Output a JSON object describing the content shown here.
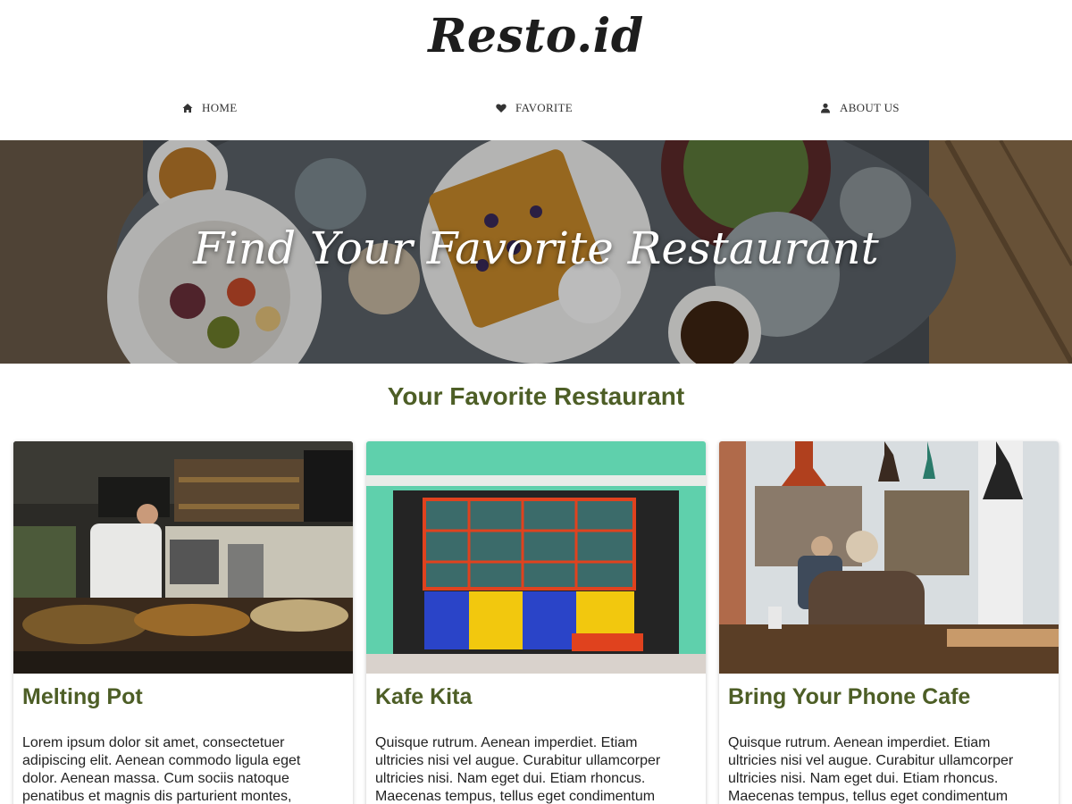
{
  "brand": {
    "logo": "Resto.id"
  },
  "nav": {
    "items": [
      {
        "label": "HOME",
        "icon": "home-icon"
      },
      {
        "label": "FAVORITE",
        "icon": "heart-icon"
      },
      {
        "label": "ABOUT US",
        "icon": "user-icon"
      }
    ]
  },
  "hero": {
    "title": "Find Your Favorite Restaurant"
  },
  "section": {
    "title": "Your Favorite Restaurant"
  },
  "restaurants": [
    {
      "name": "Melting Pot",
      "description": "Lorem ipsum dolor sit amet, consectetuer adipiscing elit. Aenean commodo ligula eget dolor. Aenean massa. Cum sociis natoque penatibus et magnis dis parturient montes,"
    },
    {
      "name": "Kafe Kita",
      "description": "Quisque rutrum. Aenean imperdiet. Etiam ultricies nisi vel augue. Curabitur ullamcorper ultricies nisi. Nam eget dui. Etiam rhoncus. Maecenas tempus, tellus eget condimentum"
    },
    {
      "name": "Bring Your Phone Cafe",
      "description": "Quisque rutrum. Aenean imperdiet. Etiam ultricies nisi vel augue. Curabitur ullamcorper ultricies nisi. Nam eget dui. Etiam rhoncus. Maecenas tempus, tellus eget condimentum"
    }
  ],
  "colors": {
    "accent": "#4d5e26",
    "text": "#222222"
  }
}
